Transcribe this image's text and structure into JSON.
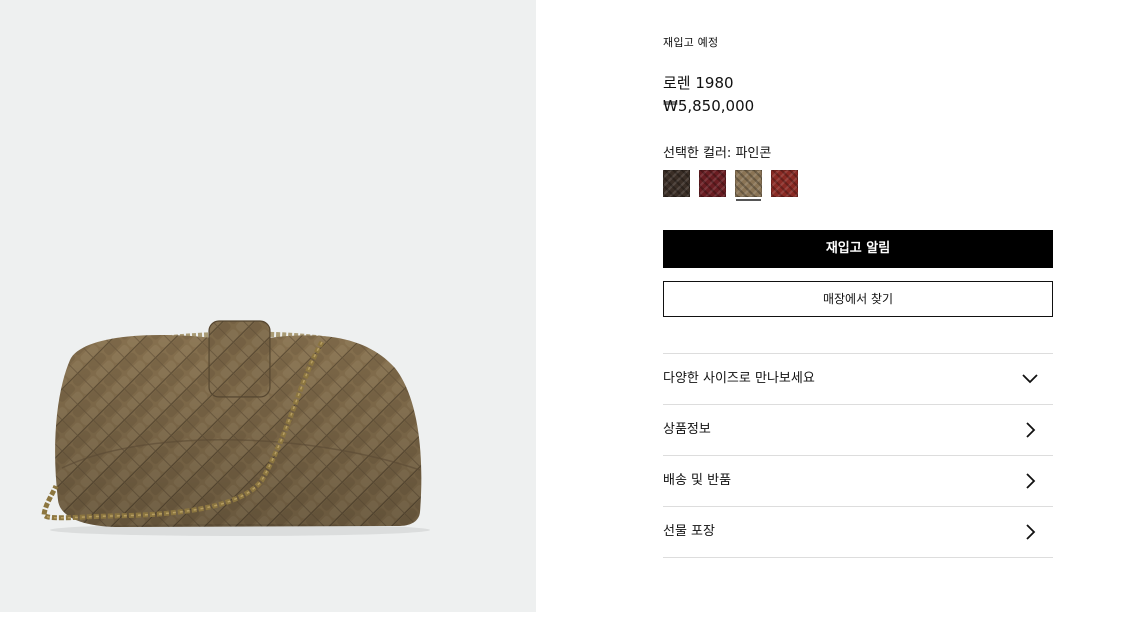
{
  "product": {
    "status": "재입고 예정",
    "name": "로렌 1980",
    "price": "₩5,850,000",
    "color_prefix": "선택한 컬러: ",
    "color_name": "파인콘",
    "image_icon": "woven-leather-clutch-bag-image"
  },
  "swatches": [
    {
      "color": "#3a2e26",
      "selected": false
    },
    {
      "color": "#6a1d22",
      "selected": false
    },
    {
      "color": "#8a7455",
      "selected": true
    },
    {
      "color": "#8a2a24",
      "selected": false
    }
  ],
  "buttons": {
    "notify": "재입고 알림",
    "find_store": "매장에서 찾기"
  },
  "accordion": [
    {
      "label": "다양한 사이즈로 만나보세요",
      "icon": "chevron-down-icon"
    },
    {
      "label": "상품정보",
      "icon": "chevron-right-icon"
    },
    {
      "label": "배송 및 반품",
      "icon": "chevron-right-icon"
    },
    {
      "label": "선물 포장",
      "icon": "chevron-right-icon"
    }
  ],
  "colors": {
    "image_background": "#eef0f0",
    "bag_leather": "#8a7455",
    "chain_gold": "#8c7640",
    "primary_button": "#000000"
  }
}
